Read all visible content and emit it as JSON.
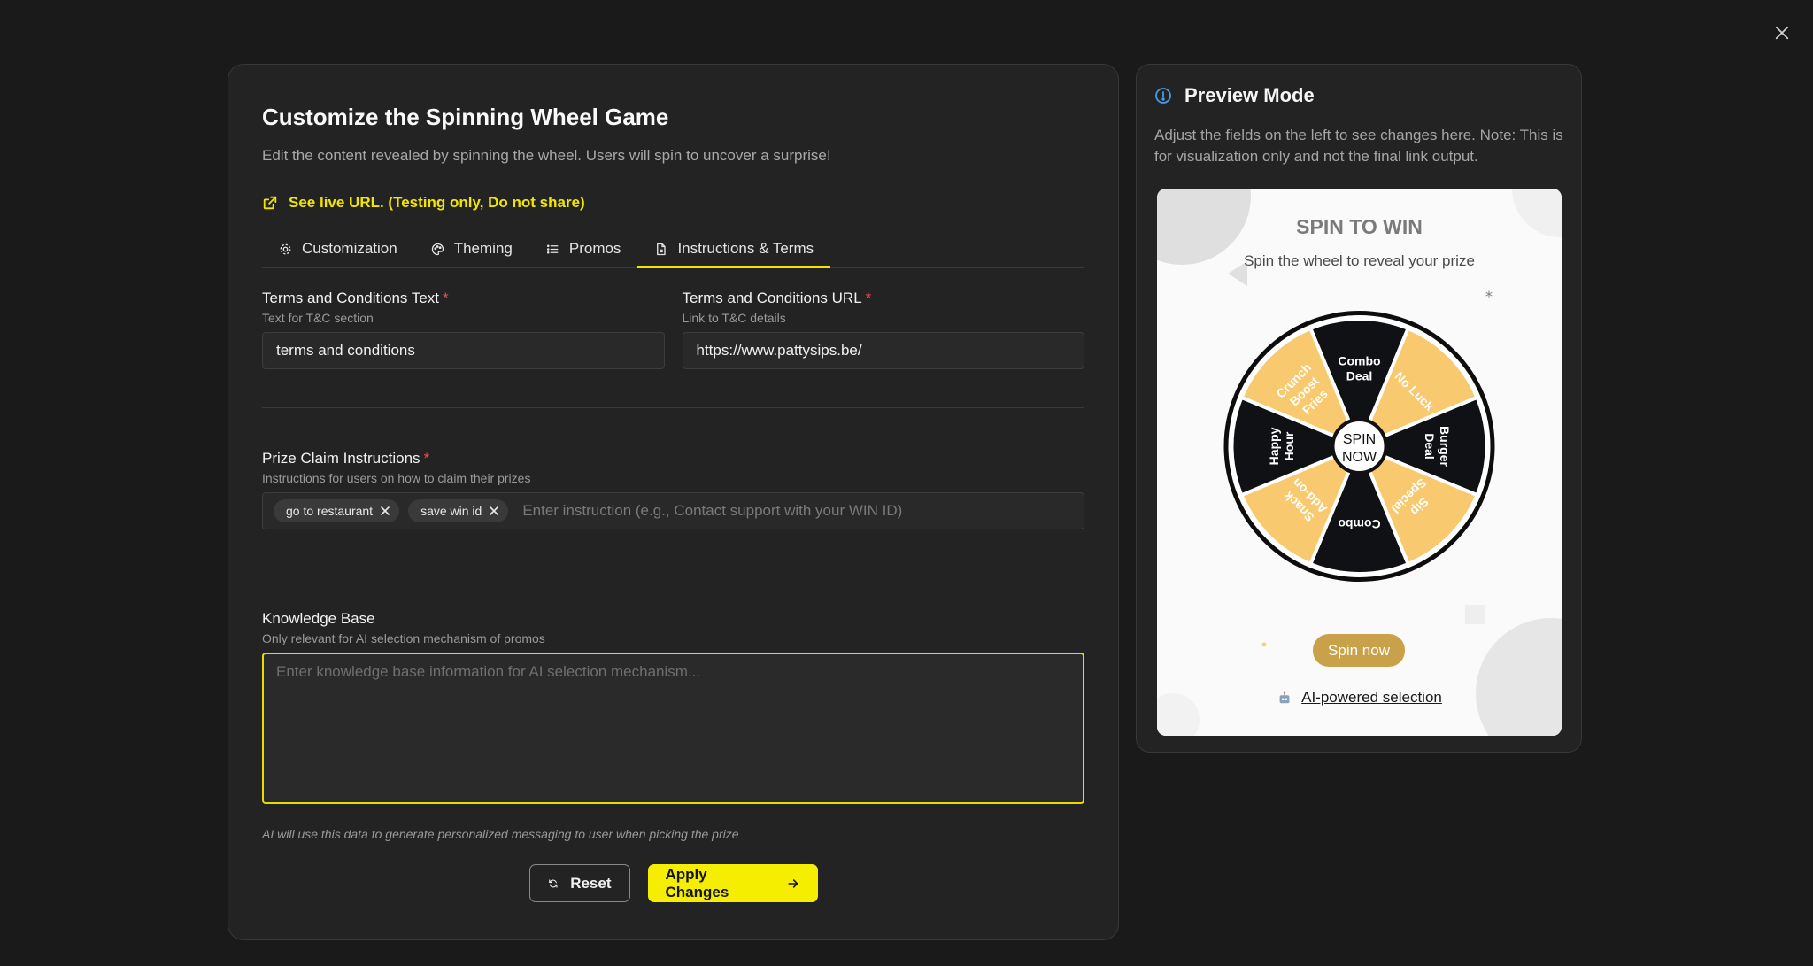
{
  "editor": {
    "title": "Customize the Spinning Wheel Game",
    "subtitle": "Edit the content revealed by spinning the wheel. Users will spin to uncover a surprise!",
    "live_link": "See live URL. (Testing only, Do not share)",
    "tabs": [
      {
        "label": "Customization",
        "icon": "gear-icon"
      },
      {
        "label": "Theming",
        "icon": "palette-icon"
      },
      {
        "label": "Promos",
        "icon": "list-icon"
      },
      {
        "label": "Instructions & Terms",
        "icon": "document-icon",
        "active": true
      }
    ],
    "tc_text": {
      "label": "Terms and Conditions Text",
      "required": "*",
      "hint": "Text for T&C section",
      "value": "terms and conditions"
    },
    "tc_url": {
      "label": "Terms and Conditions URL",
      "required": "*",
      "hint": "Link to T&C details",
      "value": "https://www.pattysips.be/"
    },
    "claim": {
      "label": "Prize Claim Instructions",
      "required": "*",
      "hint": "Instructions for users on how to claim their prizes",
      "chips": [
        "go to restaurant",
        "save win id"
      ],
      "placeholder": "Enter instruction (e.g., Contact support with your WIN ID)"
    },
    "kb": {
      "label": "Knowledge Base",
      "hint": "Only relevant for AI selection mechanism of promos",
      "placeholder": "Enter knowledge base information for AI selection mechanism..."
    },
    "ai_note": "AI will use this data to generate personalized messaging to user when picking the prize",
    "reset_label": "Reset",
    "apply_label": "Apply Changes"
  },
  "preview": {
    "title": "Preview Mode",
    "description": "Adjust the fields on the left to see changes here. Note: This is for visualization only and not the final link output.",
    "game_title": "SPIN TO WIN",
    "game_subtitle": "Spin the wheel to reveal your prize",
    "center_label": [
      "SPIN",
      "NOW"
    ],
    "spin_button": "Spin now",
    "ai_selection": "AI-powered selection",
    "segments": [
      {
        "lines": [
          "Combo",
          "Deal"
        ],
        "color": "dark"
      },
      {
        "lines": [
          "No Luck"
        ],
        "color": "light"
      },
      {
        "lines": [
          "Burger",
          "Deal"
        ],
        "color": "dark"
      },
      {
        "lines": [
          "Sip",
          "Special"
        ],
        "color": "light"
      },
      {
        "lines": [
          "Combo"
        ],
        "color": "dark"
      },
      {
        "lines": [
          "Snack",
          "Add-on"
        ],
        "color": "light"
      },
      {
        "lines": [
          "Happy",
          "Hour"
        ],
        "color": "dark"
      },
      {
        "lines": [
          "Crunch",
          "Boost",
          "Fries"
        ],
        "color": "light"
      }
    ],
    "colors": {
      "dark": "#0f1114",
      "light": "#f8c96e",
      "rim": "#0d0d0d",
      "button": "#c9a14a"
    }
  }
}
